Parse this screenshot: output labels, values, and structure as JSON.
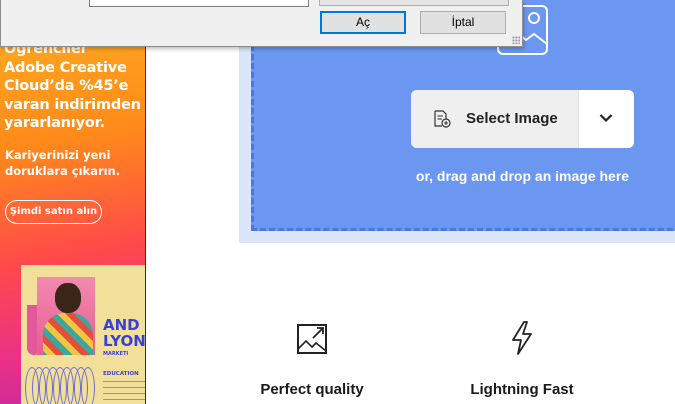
{
  "ad": {
    "headline": "Öğrenciler\nAdobe Creative\nCloud’da %45’e\nvaran indirimden\nyararlanıyor.",
    "subtext": "Kariyerinizi yeni\ndoruklara çıkarın.",
    "cta_label": "Şimdi satın alın",
    "card_name": "AND\nLYON",
    "card_market": "MARKETI",
    "card_education": "EDUCATION"
  },
  "dialog": {
    "open_label": "Aç",
    "cancel_label": "İptal"
  },
  "upload": {
    "select_label": "Select Image",
    "drag_text": "or, drag and drop an image here",
    "icons": [
      "image-icon",
      "file-add-icon",
      "chevron-down-icon"
    ]
  },
  "features": [
    {
      "label": "Perfect quality",
      "icon": "resize-image-icon"
    },
    {
      "label": "Lightning Fast",
      "icon": "lightning-icon"
    }
  ],
  "colors": {
    "upload_bg": "#6b97f0",
    "upload_outer": "#dce6fb",
    "dialog_accent": "#0078d7"
  }
}
